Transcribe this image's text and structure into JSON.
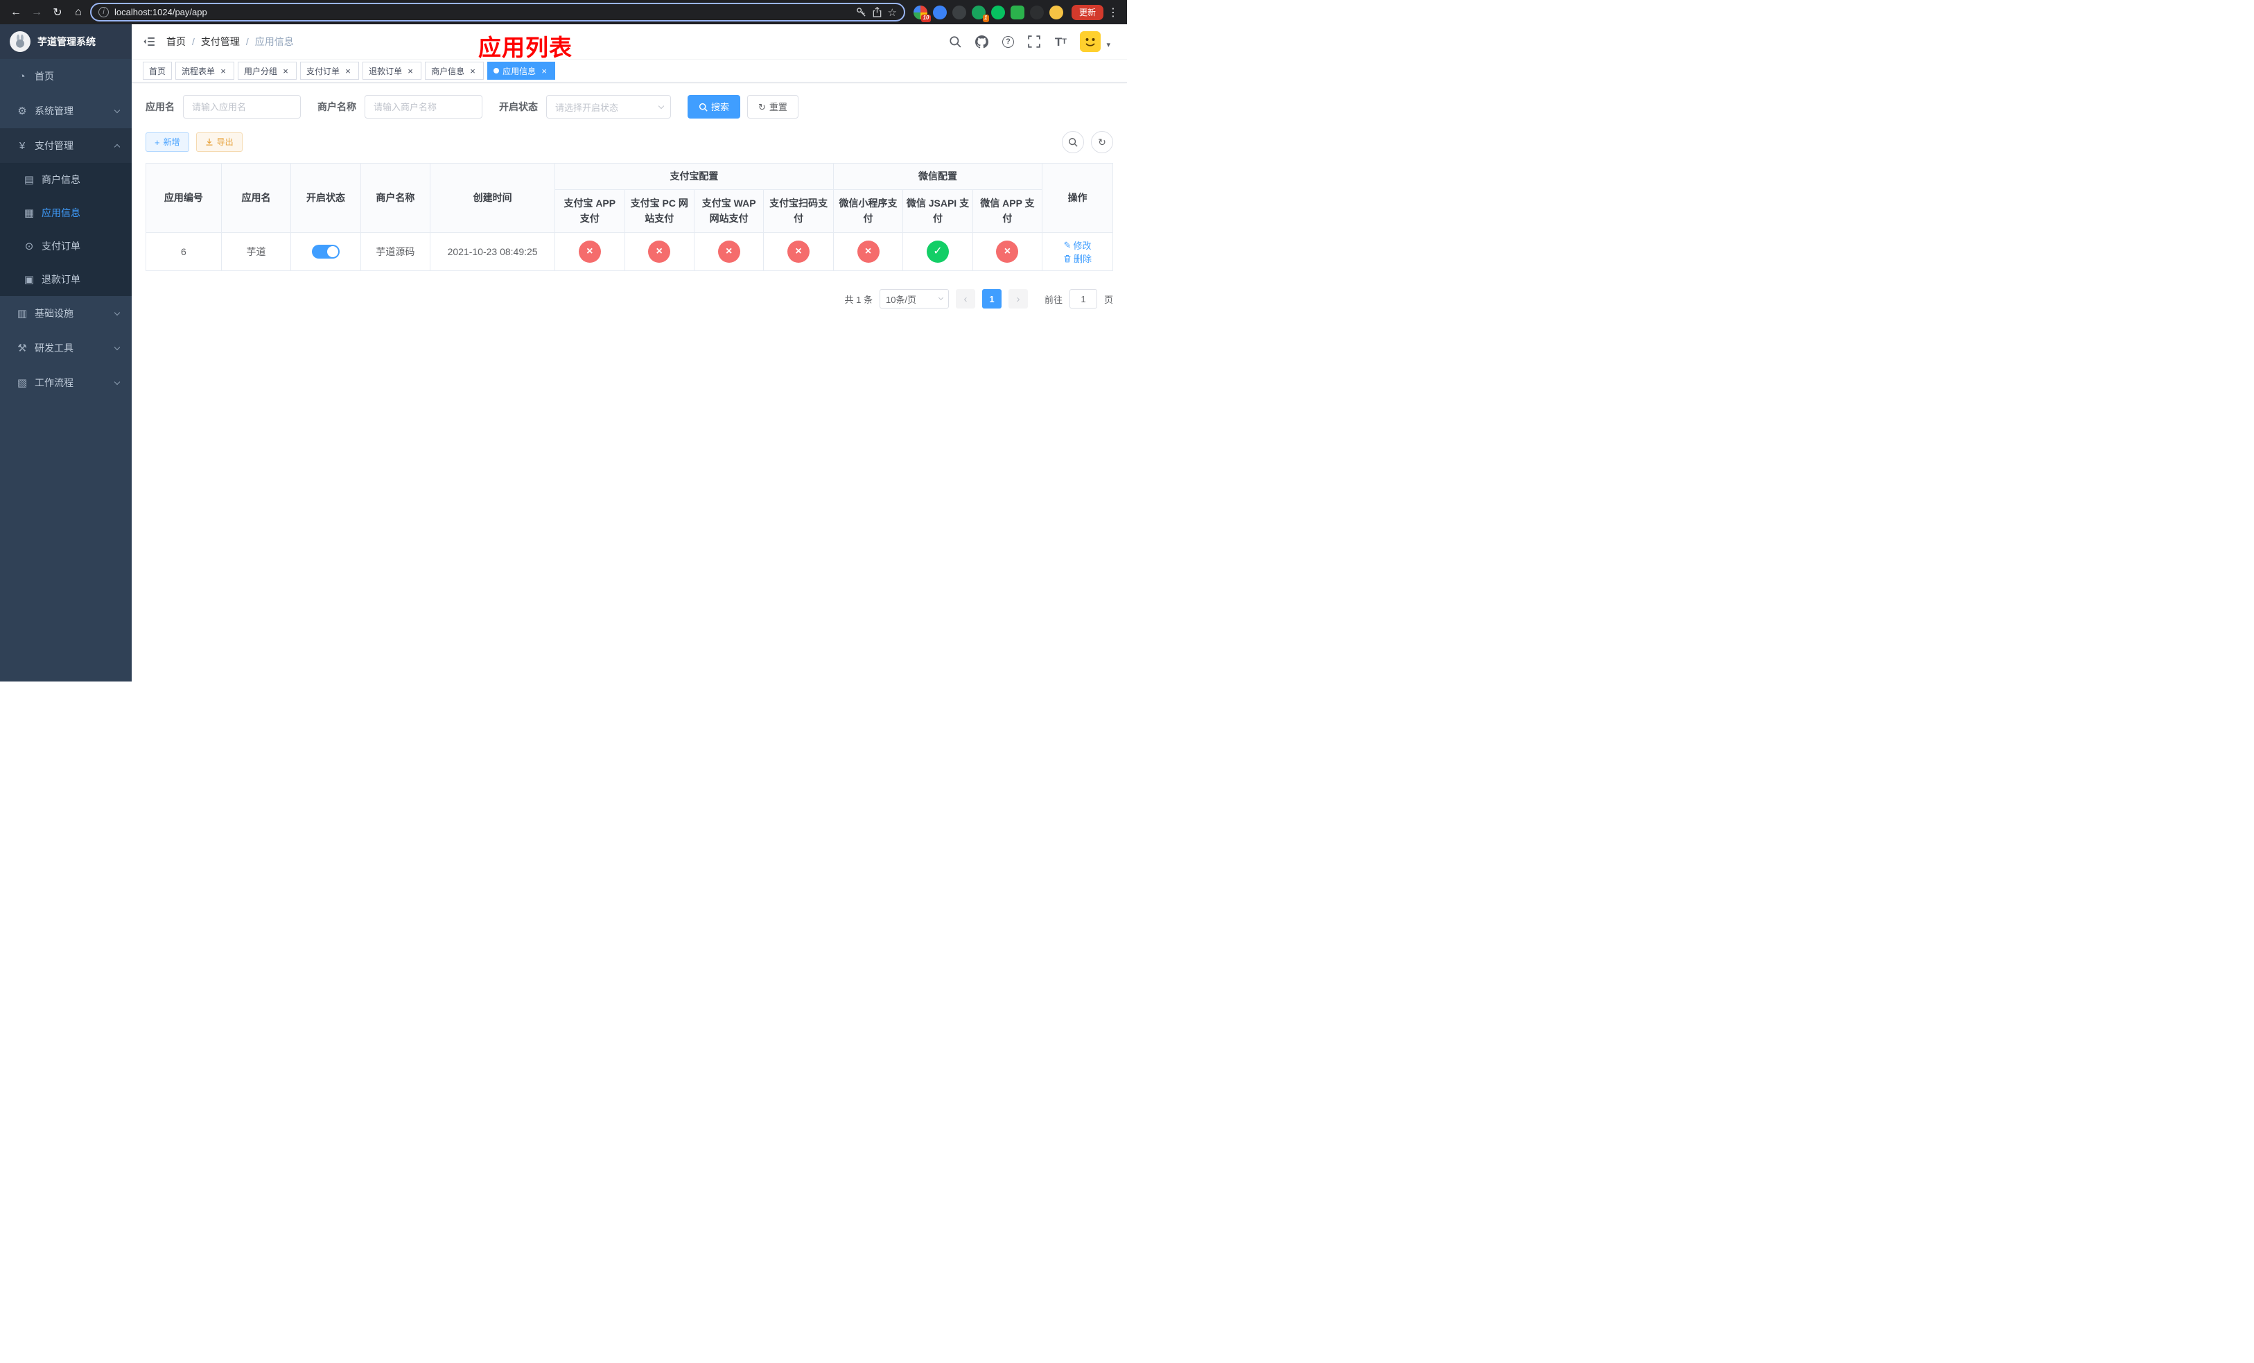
{
  "browser": {
    "url": "localhost:1024/pay/app",
    "update_label": "更新",
    "extension_badges": {
      "red": "10",
      "orange": "1"
    }
  },
  "app": {
    "title": "芋道管理系统",
    "annotation": "应用列表"
  },
  "breadcrumb": {
    "items": [
      "首页",
      "支付管理",
      "应用信息"
    ],
    "separator": "/"
  },
  "sidebar": {
    "menu": [
      {
        "label": "首页",
        "glyph": "◔"
      },
      {
        "label": "系统管理",
        "glyph": "⚙"
      },
      {
        "label": "支付管理",
        "glyph": "¥"
      },
      {
        "label": "基础设施",
        "glyph": "▥"
      },
      {
        "label": "研发工具",
        "glyph": "⚒"
      },
      {
        "label": "工作流程",
        "glyph": "▧"
      }
    ],
    "payment_submenu": [
      {
        "label": "商户信息",
        "glyph": "▤"
      },
      {
        "label": "应用信息",
        "glyph": "▦"
      },
      {
        "label": "支付订单",
        "glyph": "⊙"
      },
      {
        "label": "退款订单",
        "glyph": "▣"
      }
    ]
  },
  "tabs": [
    "首页",
    "流程表单",
    "用户分组",
    "支付订单",
    "退款订单",
    "商户信息",
    "应用信息"
  ],
  "filters": {
    "app_name_label": "应用名",
    "app_name_placeholder": "请输入应用名",
    "merchant_label": "商户名称",
    "merchant_placeholder": "请输入商户名称",
    "status_label": "开启状态",
    "status_placeholder": "请选择开启状态",
    "search_label": "搜索",
    "reset_label": "重置"
  },
  "toolbar": {
    "add_label": "新增",
    "export_label": "导出"
  },
  "table": {
    "headers": {
      "app_id": "应用编号",
      "app_name": "应用名",
      "status": "开启状态",
      "merchant": "商户名称",
      "created": "创建时间",
      "alipay_group": "支付宝配置",
      "wechat_group": "微信配置",
      "actions": "操作",
      "alipay_app": "支付宝 APP 支付",
      "alipay_pc": "支付宝 PC 网站支付",
      "alipay_wap": "支付宝 WAP 网站支付",
      "alipay_qr": "支付宝扫码支付",
      "wx_mini": "微信小程序支付",
      "wx_jsapi": "微信 JSAPI 支付",
      "wx_app": "微信 APP 支付"
    },
    "row": {
      "app_id": "6",
      "app_name": "芋道",
      "status_on": true,
      "merchant": "芋道源码",
      "created": "2021-10-23 08:49:25",
      "configs": {
        "alipay_app": false,
        "alipay_pc": false,
        "alipay_wap": false,
        "alipay_qr": false,
        "wx_mini": false,
        "wx_jsapi": true,
        "wx_app": false
      },
      "edit_label": "修改",
      "delete_label": "删除"
    }
  },
  "pagination": {
    "total_text": "共 1 条",
    "page_size_text": "10条/页",
    "page": "1",
    "goto_prefix": "前往",
    "goto_value": "1",
    "goto_suffix": "页"
  },
  "icons": {
    "back": "←",
    "forward": "→",
    "reload": "↻",
    "home": "⌂",
    "star": "☆",
    "info": "i",
    "menu_dots": "⋮",
    "close": "×",
    "caret_down": "▾",
    "plus": "+",
    "refresh": "↻",
    "edit": "✎",
    "prev": "‹",
    "next": "›",
    "check": "✓",
    "cross": "×",
    "help": "?"
  },
  "colors": {
    "primary": "#409EFF",
    "danger": "#F56C6C",
    "success": "#13CE66",
    "warning": "#E6A23C",
    "annotation": "#FF0000"
  }
}
